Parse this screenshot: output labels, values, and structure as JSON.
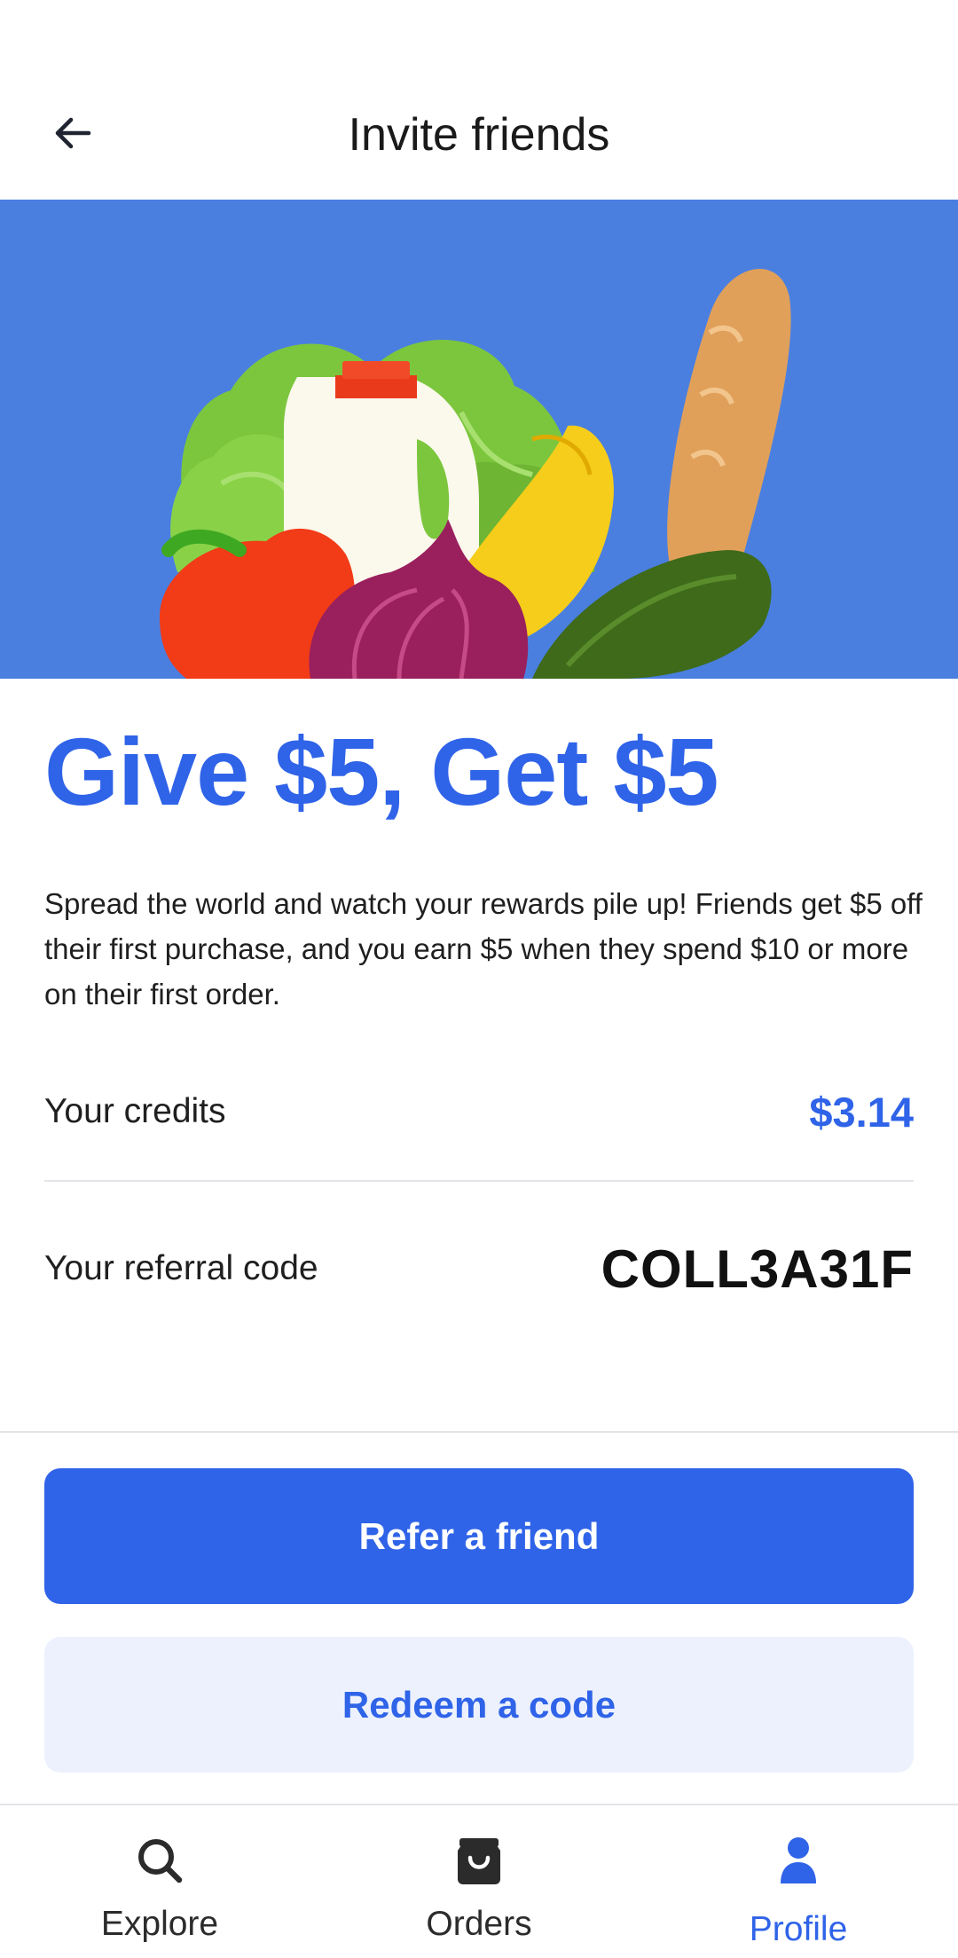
{
  "header": {
    "title": "Invite friends",
    "back_icon": "arrow-left-icon"
  },
  "hero": {
    "background_color": "#4a7fe0",
    "illustration": "grocery-illustration"
  },
  "promo": {
    "headline": "Give $5, Get $5",
    "description": "Spread the world and watch your rewards pile up! Friends get $5 off their first purchase, and you earn $5 when they spend $10 or more on their first order."
  },
  "credits": {
    "label": "Your credits",
    "value": "$3.14"
  },
  "referral": {
    "label": "Your referral code",
    "code": "COLL3A31F"
  },
  "actions": {
    "refer_label": "Refer a friend",
    "redeem_label": "Redeem a code"
  },
  "bottom_nav": {
    "items": [
      {
        "label": "Explore",
        "icon": "search-icon",
        "active": false
      },
      {
        "label": "Orders",
        "icon": "shopping-bag-icon",
        "active": false
      },
      {
        "label": "Profile",
        "icon": "person-icon",
        "active": true
      }
    ]
  },
  "colors": {
    "accent": "#2f63e8",
    "accent_light": "#ecf1fd",
    "text_primary": "#1a1a1a",
    "divider": "#e3e4e8"
  }
}
